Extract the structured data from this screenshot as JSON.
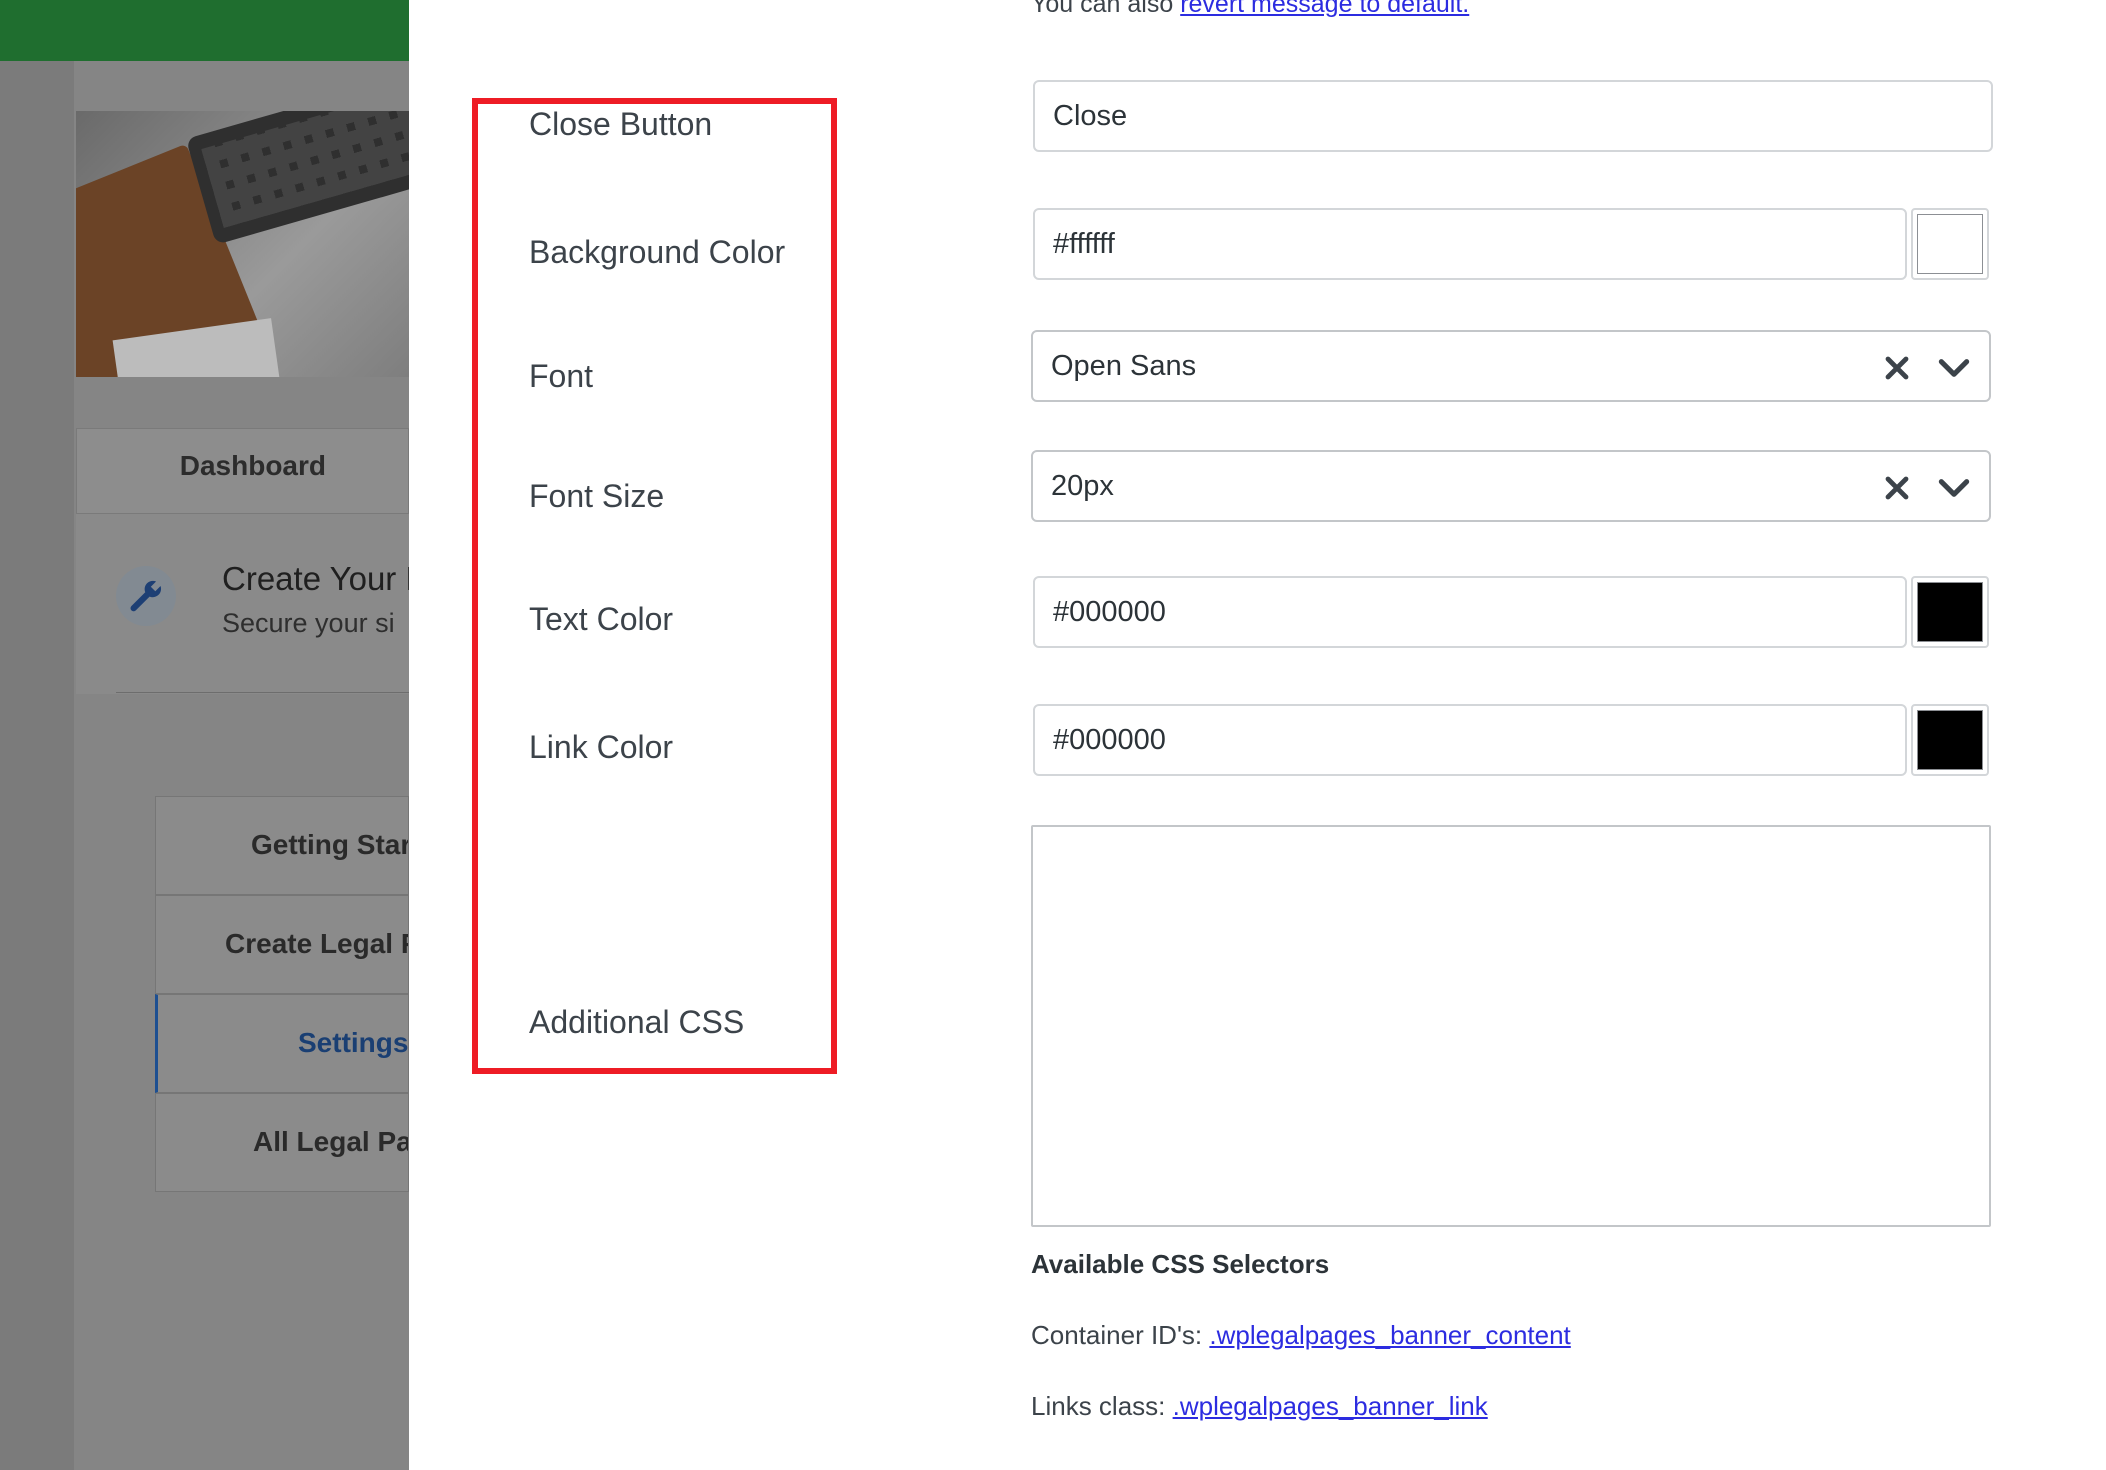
{
  "background_page": {
    "nav_dashboard": "Dashboard",
    "create_title": "Create Your L",
    "create_subtitle": "Secure your si",
    "menu": [
      {
        "label": "Getting Star"
      },
      {
        "label": "Create Legal P"
      },
      {
        "label": "Settings"
      },
      {
        "label": "All Legal Pa"
      }
    ]
  },
  "top_note": {
    "text": "You can also ",
    "link_text": "revert message to default."
  },
  "labels": {
    "close_button": "Close Button",
    "background_color": "Background Color",
    "font": "Font",
    "font_size": "Font Size",
    "text_color": "Text Color",
    "link_color": "Link Color",
    "additional_css": "Additional CSS"
  },
  "fields": {
    "close_button_text": "Close",
    "background_color": "#ffffff",
    "font": "Open Sans",
    "font_size": "20px",
    "text_color": "#000000",
    "link_color": "#000000",
    "additional_css": ""
  },
  "colors": {
    "background_swatch": "#ffffff",
    "text_swatch": "#000000",
    "link_swatch": "#000000",
    "highlight_border": "#ee1c25"
  },
  "css_help": {
    "title": "Available CSS Selectors",
    "container_label": "Container ID's: ",
    "container_link": ".wplegalpages_banner_content",
    "links_label": "Links class: ",
    "links_link": ".wplegalpages_banner_link"
  },
  "icons": {
    "clear": "clear-x-icon",
    "chevron": "chevron-down-icon",
    "wrench": "wrench-icon"
  }
}
